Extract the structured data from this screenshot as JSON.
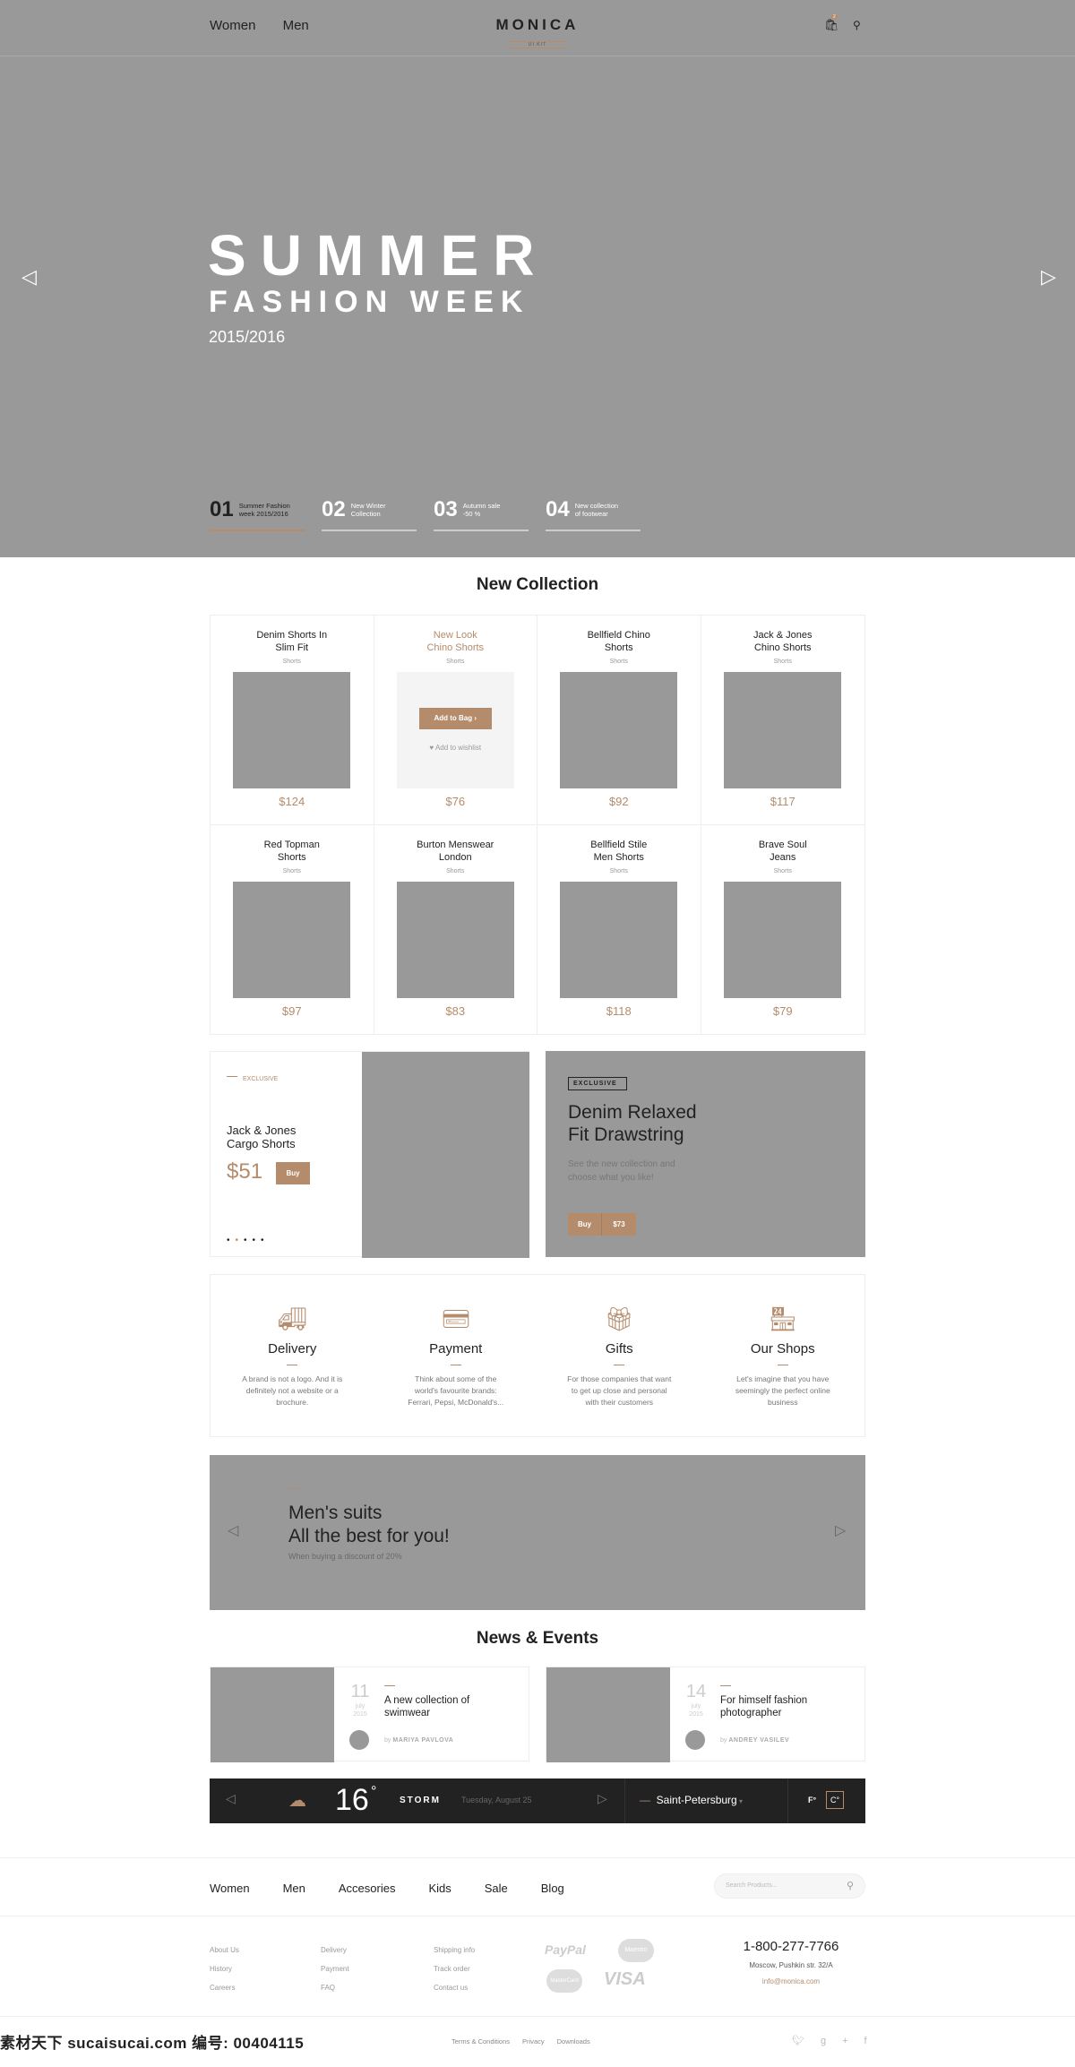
{
  "header": {
    "nav": [
      "Women",
      "Men"
    ],
    "logo": "MONICA",
    "logo_sub": "UI KIT",
    "cart_count": "2"
  },
  "hero": {
    "title": "SUMMER",
    "subtitle": "FASHION WEEK",
    "years": "2015/2016",
    "slides": [
      {
        "num": "01",
        "text1": "Summer Fashion",
        "text2": "week 2015/2016"
      },
      {
        "num": "02",
        "text1": "New Winter",
        "text2": "Collection"
      },
      {
        "num": "03",
        "text1": "Autumn sale",
        "text2": "-50 %"
      },
      {
        "num": "04",
        "text1": "New collection",
        "text2": "of footwear"
      }
    ]
  },
  "collection": {
    "title": "New Collection",
    "add_to_bag": "Add to Bag",
    "add_to_wishlist": "Add to wishlist",
    "products": [
      {
        "l1": "Denim Shorts In",
        "l2": "Slim Fit",
        "cat": "Shorts",
        "price": "$124"
      },
      {
        "l1": "New Look",
        "l2": "Chino Shorts",
        "cat": "Shorts",
        "price": "$76"
      },
      {
        "l1": "Bellfield Chino",
        "l2": "Shorts",
        "cat": "Shorts",
        "price": "$92"
      },
      {
        "l1": "Jack & Jones",
        "l2": "Chino Shorts",
        "cat": "Shorts",
        "price": "$117"
      },
      {
        "l1": "Red Topman",
        "l2": "Shorts",
        "cat": "Shorts",
        "price": "$97"
      },
      {
        "l1": "Burton Menswear",
        "l2": "London",
        "cat": "Shorts",
        "price": "$83"
      },
      {
        "l1": "Bellfield Stile",
        "l2": "Men Shorts",
        "cat": "Shorts",
        "price": "$118"
      },
      {
        "l1": "Brave Soul",
        "l2": "Jeans",
        "cat": "Shorts",
        "price": "$79"
      }
    ]
  },
  "promo_left": {
    "tag": "EXCLUSIVE",
    "l1": "Jack & Jones",
    "l2": "Cargo Shorts",
    "price": "$51",
    "buy": "Buy"
  },
  "promo_right": {
    "tag": "EXCLUSIVE",
    "l1": "Denim Relaxed",
    "l2": "Fit Drawstring",
    "d1": "See the new collection and",
    "d2": "choose what you like!",
    "buy": "Buy",
    "price": "$73"
  },
  "features": [
    {
      "title": "Delivery",
      "l1": "A brand is not a logo. And it is",
      "l2": "definitely not a website or a",
      "l3": "brochure."
    },
    {
      "title": "Payment",
      "l1": "Think about some of the",
      "l2": "world's favourite brands:",
      "l3": "Ferrari, Pepsi, McDonald's..."
    },
    {
      "title": "Gifts",
      "l1": "For those companies that want",
      "l2": "to get up close and personal",
      "l3": "with their customers"
    },
    {
      "title": "Our Shops",
      "l1": "Let's imagine that you have",
      "l2": "seemingly the perfect online",
      "l3": "business"
    }
  ],
  "banner": {
    "l1": "Men's suits",
    "l2": "All the best for you!",
    "sub": "When buying a discount of 20%"
  },
  "news": {
    "title": "News & Events",
    "items": [
      {
        "day": "11",
        "month": "july",
        "year": "2015",
        "l1": "A new collection of",
        "l2": "swimwear",
        "by": "by",
        "author": "MARIYA PAVLOVA"
      },
      {
        "day": "14",
        "month": "july",
        "year": "2015",
        "l1": "For himself fashion",
        "l2": "photographer",
        "by": "by",
        "author": "ANDREY VASILEV"
      }
    ]
  },
  "weather": {
    "temp": "16",
    "deg": "°",
    "cond": "STORM",
    "date": "Tuesday, August 25",
    "city": "Saint-Petersburg",
    "f": "F°",
    "c": "C°"
  },
  "footer": {
    "nav": [
      "Women",
      "Men",
      "Accesories",
      "Kids",
      "Sale",
      "Blog"
    ],
    "search_placeholder": "Search Products...",
    "col1": [
      "About Us",
      "History",
      "Careers"
    ],
    "col2": [
      "Delivery",
      "Payment",
      "FAQ"
    ],
    "col3": [
      "Shipping info",
      "Track order",
      "Contact us"
    ],
    "payments": [
      "PayPal",
      "Maestro",
      "MasterCard",
      "VISA"
    ],
    "phone": "1-800-277-7766",
    "address": "Moscow, Pushkin str. 32/A",
    "email": "info@monica.com",
    "links": [
      "Terms & Conditions",
      "Privacy",
      "Downloads"
    ],
    "social": [
      "twitter",
      "google-plus",
      "facebook"
    ]
  },
  "watermark": "素材天下 sucaisucai.com  编号: 00404115",
  "colors": {
    "accent": "#b48c6c",
    "placeholder": "#999999",
    "dark": "#222222"
  }
}
